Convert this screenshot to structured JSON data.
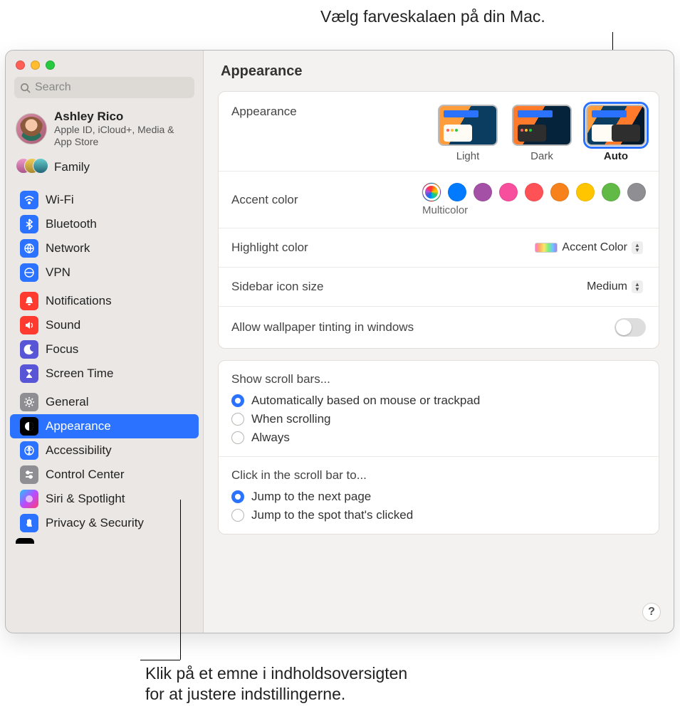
{
  "callouts": {
    "top": "Vælg farveskalaen på din Mac.",
    "bottom_line1": "Klik på et emne i indholdsoversigten",
    "bottom_line2": "for at justere indstillingerne."
  },
  "window": {
    "title": "Appearance"
  },
  "search": {
    "placeholder": "Search"
  },
  "account": {
    "name": "Ashley Rico",
    "subtitle": "Apple ID, iCloud+, Media & App Store"
  },
  "family": {
    "label": "Family"
  },
  "sidebar": {
    "group1": [
      {
        "label": "Wi-Fi",
        "icon": "wifi",
        "color": "ic-blue"
      },
      {
        "label": "Bluetooth",
        "icon": "bluetooth",
        "color": "ic-blue"
      },
      {
        "label": "Network",
        "icon": "network",
        "color": "ic-blue"
      },
      {
        "label": "VPN",
        "icon": "vpn",
        "color": "ic-blue"
      }
    ],
    "group2": [
      {
        "label": "Notifications",
        "icon": "bell",
        "color": "ic-red"
      },
      {
        "label": "Sound",
        "icon": "sound",
        "color": "ic-red"
      },
      {
        "label": "Focus",
        "icon": "moon",
        "color": "ic-purple"
      },
      {
        "label": "Screen Time",
        "icon": "hourglass",
        "color": "ic-purple"
      }
    ],
    "group3": [
      {
        "label": "General",
        "icon": "gear",
        "color": "ic-gray"
      },
      {
        "label": "Appearance",
        "icon": "appearance",
        "color": "ic-black",
        "selected": true
      },
      {
        "label": "Accessibility",
        "icon": "accessibility",
        "color": "ic-blue"
      },
      {
        "label": "Control Center",
        "icon": "controls",
        "color": "ic-gray"
      },
      {
        "label": "Siri & Spotlight",
        "icon": "siri",
        "color": "ic-siri"
      },
      {
        "label": "Privacy & Security",
        "icon": "hand",
        "color": "ic-blue"
      }
    ]
  },
  "appearance": {
    "label": "Appearance",
    "options": [
      {
        "label": "Light",
        "selected": false
      },
      {
        "label": "Dark",
        "selected": false
      },
      {
        "label": "Auto",
        "selected": true
      }
    ]
  },
  "accent": {
    "label": "Accent color",
    "sub": "Multicolor",
    "colors": [
      {
        "c": "multi",
        "selected": true
      },
      {
        "c": "#007aff"
      },
      {
        "c": "#a550a7"
      },
      {
        "c": "#f74f9e"
      },
      {
        "c": "#ff3b30"
      },
      {
        "c": "#f7821b"
      },
      {
        "c": "#ffc600"
      },
      {
        "c": "#62ba46"
      },
      {
        "c": "#8e8e93"
      }
    ]
  },
  "highlight": {
    "label": "Highlight color",
    "value": "Accent Color"
  },
  "sidebar_icon": {
    "label": "Sidebar icon size",
    "value": "Medium"
  },
  "tinting": {
    "label": "Allow wallpaper tinting in windows",
    "on": false
  },
  "scrollbars": {
    "header": "Show scroll bars...",
    "options": [
      {
        "label": "Automatically based on mouse or trackpad",
        "checked": true
      },
      {
        "label": "When scrolling",
        "checked": false
      },
      {
        "label": "Always",
        "checked": false
      }
    ]
  },
  "scrollclick": {
    "header": "Click in the scroll bar to...",
    "options": [
      {
        "label": "Jump to the next page",
        "checked": true
      },
      {
        "label": "Jump to the spot that's clicked",
        "checked": false
      }
    ]
  },
  "help": "?"
}
